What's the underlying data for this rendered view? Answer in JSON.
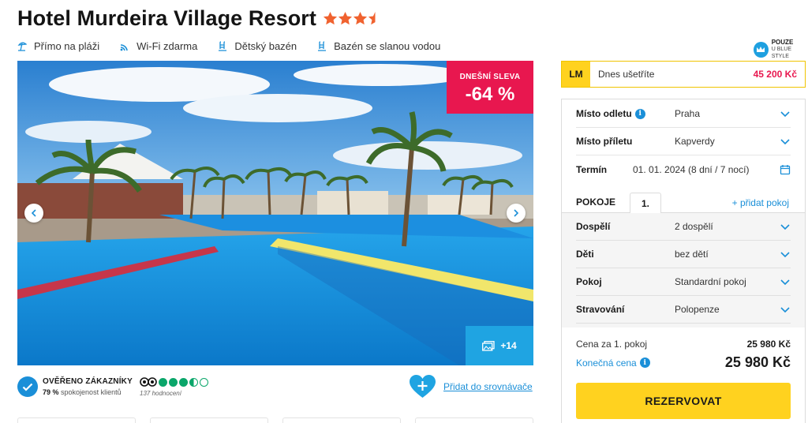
{
  "hotel": {
    "title": "Hotel Murdeira Village Resort",
    "stars": 3.5,
    "star_color": "#f0622f"
  },
  "amenities": [
    {
      "label": "Přímo na pláži",
      "icon": "beach-icon"
    },
    {
      "label": "Wi-Fi zdarma",
      "icon": "wifi-icon"
    },
    {
      "label": "Dětský bazén",
      "icon": "pool-ladder-icon"
    },
    {
      "label": "Bazén se slanou vodou",
      "icon": "pool-ladder-icon"
    }
  ],
  "blue_style": {
    "line1": "POUZE",
    "line2": "U BLUE STYLE"
  },
  "gallery": {
    "discount_label": "DNEŠNÍ SLEVA",
    "discount_value": "-64 %",
    "more_photos": "+14"
  },
  "verified": {
    "title": "OVĚŘENO ZÁKAZNÍKY",
    "percent": "79 %",
    "satisfaction": "spokojenost klientů"
  },
  "tripadvisor": {
    "rating": 3.5,
    "reviews": "137 hodnocení"
  },
  "compare": {
    "label": "Přidat do srovnávače"
  },
  "last_minute": {
    "badge": "LM",
    "text": "Dnes ušetříte",
    "amount": "45 200 Kč"
  },
  "booking": {
    "departure": {
      "label": "Místo odletu",
      "value": "Praha"
    },
    "arrival": {
      "label": "Místo příletu",
      "value": "Kapverdy"
    },
    "term": {
      "label": "Termín",
      "value": "01. 01. 2024 (8 dní / 7 nocí)"
    },
    "rooms_label": "POKOJE",
    "room_tab": "1.",
    "add_room": "+ přidat pokoj",
    "adults": {
      "label": "Dospělí",
      "value": "2 dospělí"
    },
    "children": {
      "label": "Děti",
      "value": "bez dětí"
    },
    "room": {
      "label": "Pokoj",
      "value": "Standardní pokoj"
    },
    "board": {
      "label": "Stravování",
      "value": "Polopenze"
    },
    "price_room_label": "Cena za 1. pokoj",
    "price_room_value": "25 980 Kč",
    "final_price_label": "Konečná cena",
    "final_price_value": "25 980 Kč",
    "reserve_label": "REZERVOVAT"
  },
  "colors": {
    "accent_blue": "#1a8fd8",
    "discount_red": "#e8174f",
    "reserve_yellow": "#ffd21f"
  }
}
